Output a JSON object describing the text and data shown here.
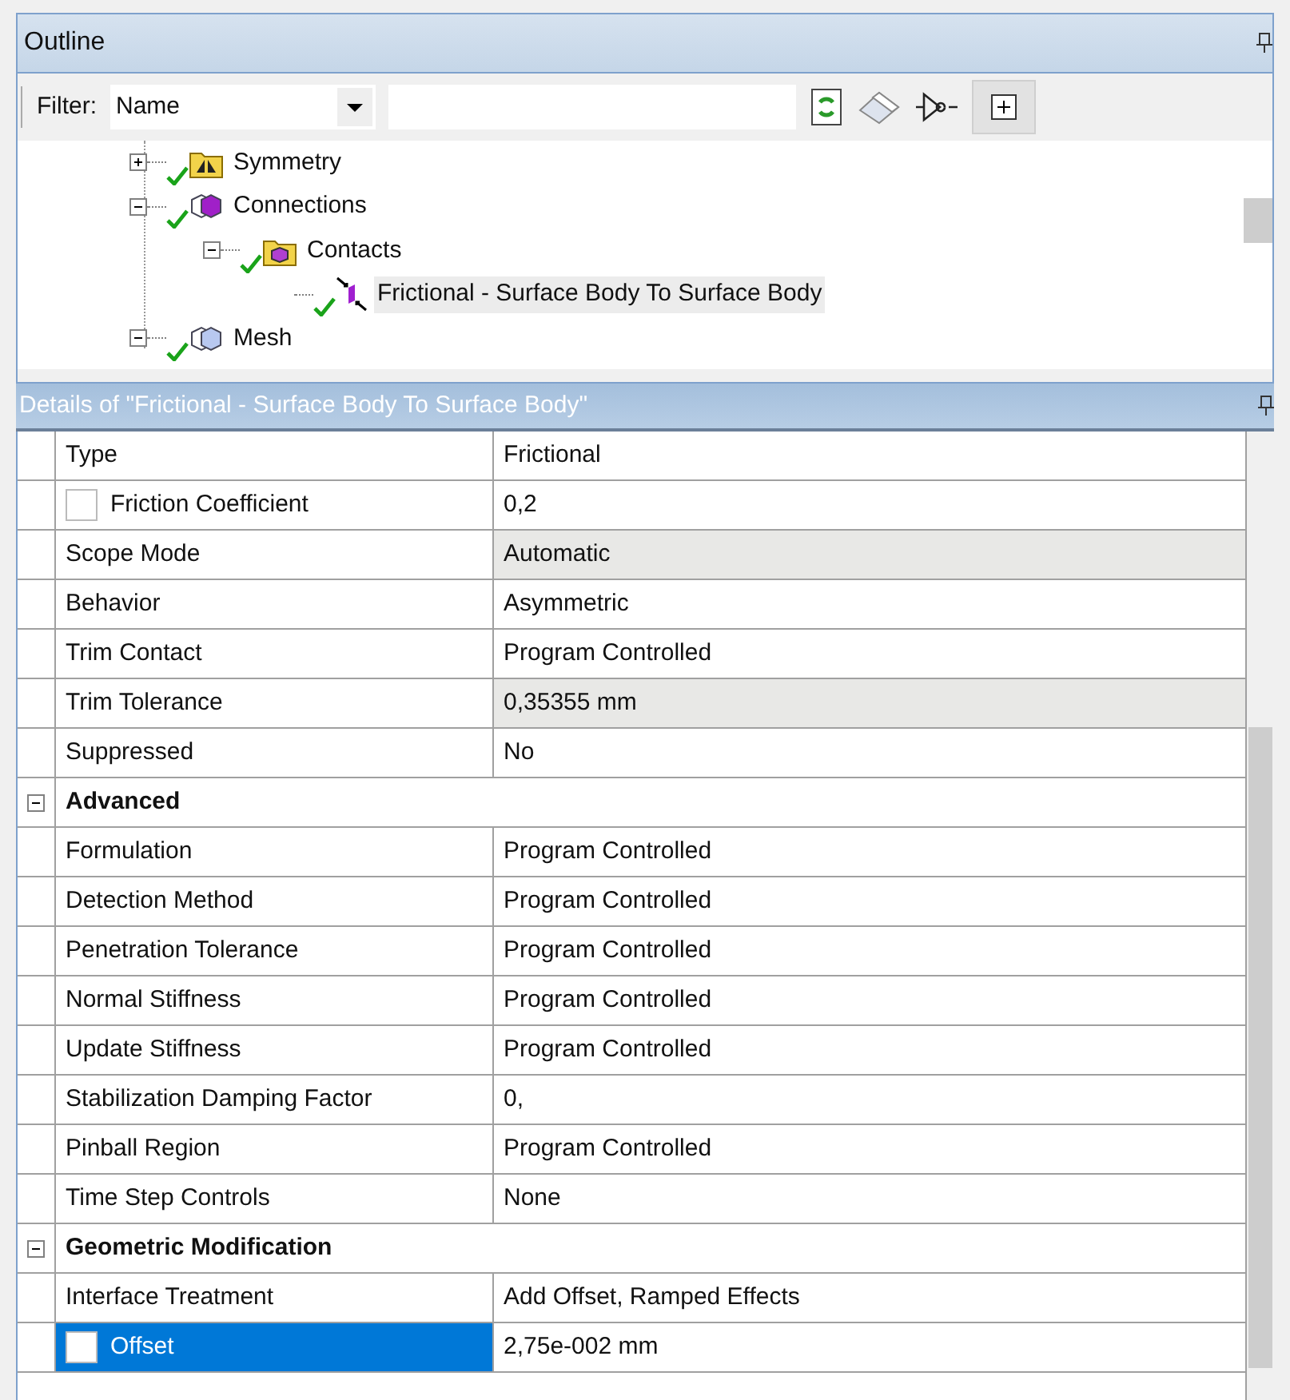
{
  "outline": {
    "title": "Outline",
    "filter": {
      "label": "Filter:",
      "value": "Name"
    },
    "tree": [
      {
        "label": "Symmetry",
        "kind": "symmetry",
        "expanded": false,
        "selected": false
      },
      {
        "label": "Connections",
        "kind": "connections",
        "expanded": true,
        "selected": false,
        "children": [
          {
            "label": "Contacts",
            "kind": "contacts",
            "expanded": true,
            "selected": false,
            "children": [
              {
                "label": "Frictional - Surface Body To Surface Body",
                "kind": "contact",
                "selected": true
              }
            ]
          }
        ]
      },
      {
        "label": "Mesh",
        "kind": "mesh",
        "expanded": true,
        "selected": false
      }
    ]
  },
  "details": {
    "title": "Details of \"Frictional - Surface Body To Surface Body\"",
    "rows": [
      {
        "kind": "property",
        "name": "Type",
        "value": "Frictional",
        "shaded": false
      },
      {
        "kind": "property",
        "name": "Friction Coefficient",
        "value": "0,2",
        "shaded": false,
        "checked": false,
        "selected": false
      },
      {
        "kind": "property",
        "name": "Scope Mode",
        "value": "Automatic",
        "shaded": true
      },
      {
        "kind": "property",
        "name": "Behavior",
        "value": "Asymmetric",
        "shaded": false
      },
      {
        "kind": "property",
        "name": "Trim Contact",
        "value": "Program Controlled",
        "shaded": false
      },
      {
        "kind": "property",
        "name": "Trim Tolerance",
        "value": "0,35355 mm",
        "shaded": true
      },
      {
        "kind": "property",
        "name": "Suppressed",
        "value": "No",
        "shaded": false
      },
      {
        "kind": "section",
        "name": "Advanced",
        "expanded": true
      },
      {
        "kind": "property",
        "name": "Formulation",
        "value": "Program Controlled",
        "shaded": false
      },
      {
        "kind": "property",
        "name": "Detection Method",
        "value": "Program Controlled",
        "shaded": false
      },
      {
        "kind": "property",
        "name": "Penetration Tolerance",
        "value": "Program Controlled",
        "shaded": false
      },
      {
        "kind": "property",
        "name": "Normal Stiffness",
        "value": "Program Controlled",
        "shaded": false
      },
      {
        "kind": "property",
        "name": "Update Stiffness",
        "value": "Program Controlled",
        "shaded": false
      },
      {
        "kind": "property",
        "name": "Stabilization Damping Factor",
        "value": "0,",
        "shaded": false
      },
      {
        "kind": "property",
        "name": "Pinball Region",
        "value": "Program Controlled",
        "shaded": false
      },
      {
        "kind": "property",
        "name": "Time Step Controls",
        "value": "None",
        "shaded": false
      },
      {
        "kind": "section",
        "name": "Geometric Modification",
        "expanded": true
      },
      {
        "kind": "property",
        "name": "Interface Treatment",
        "value": "Add Offset, Ramped Effects",
        "shaded": false
      },
      {
        "kind": "property",
        "name": "Offset",
        "value": "2,75e-002 mm",
        "shaded": false,
        "checked": false,
        "selected": true
      }
    ]
  }
}
